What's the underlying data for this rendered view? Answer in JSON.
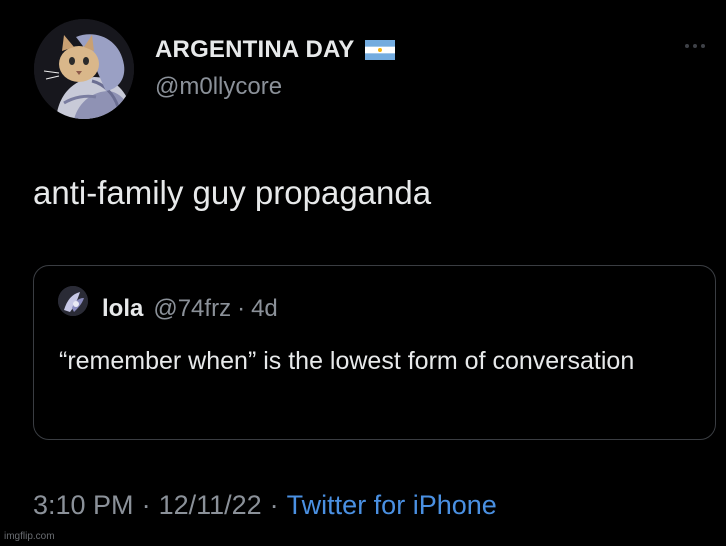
{
  "author": {
    "name": "ARGENTINA DAY",
    "handle": "@m0llycore",
    "flag": "argentina-flag-icon"
  },
  "tweet": {
    "text": "anti-family guy propaganda"
  },
  "quote": {
    "name": "lola",
    "handle": "@74frz",
    "separator": "·",
    "time": "4d",
    "text": "“remember when” is the lowest form of conversation"
  },
  "meta": {
    "time": "3:10 PM",
    "separator1": "·",
    "date": "12/11/22",
    "separator2": "·",
    "source": "Twitter for iPhone"
  },
  "watermark": "imgflip.com",
  "colors": {
    "background": "#000000",
    "text": "#e7e9ea",
    "secondary": "#8b9199",
    "link": "#4a90e2",
    "border": "#3a3d42"
  }
}
